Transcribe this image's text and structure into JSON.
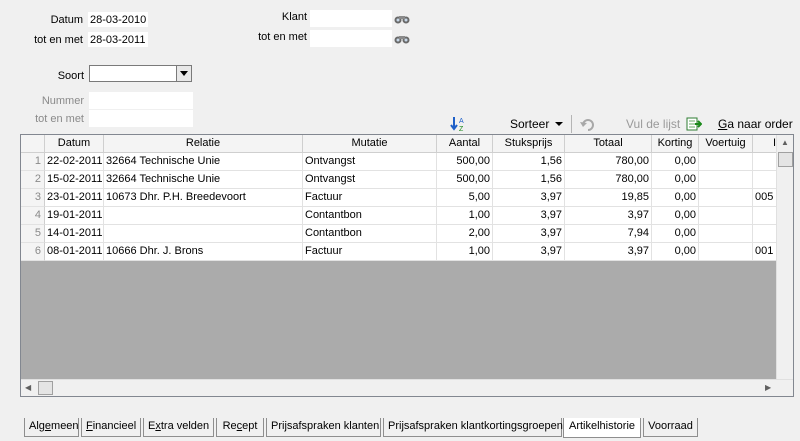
{
  "filters": {
    "datum_label": "Datum",
    "datum_value": "28-03-2010",
    "tot_en_met_label": "tot en met",
    "tot_en_met_value": "28-03-2011",
    "klant_label": "Klant",
    "klant_value": "",
    "klant_tot_label": "tot en met",
    "klant_tot_value": "",
    "soort_label": "Soort",
    "soort_value": "",
    "nummer_label": "Nummer",
    "nummer_value": "",
    "nummer_tot_label": "tot en met",
    "nummer_tot_value": ""
  },
  "toolbar": {
    "sort_icon": "sort-az-icon",
    "sort_label": "Sorteer",
    "fill_icon": "undo-icon",
    "fill_label": "Vul de lijst",
    "goto_icon": "export-green-icon",
    "goto_label": "Ga naar order"
  },
  "grid": {
    "columns": [
      "Datum",
      "Relatie",
      "Mutatie",
      "Aantal",
      "Stuksprijs",
      "Totaal",
      "Korting",
      "Voertuig",
      "I"
    ],
    "rows": [
      {
        "n": "1",
        "datum": "22-02-2011",
        "relatie": "32664 Technische Unie",
        "mutatie": "Ontvangst",
        "aantal": "500,00",
        "stuksprijs": "1,56",
        "totaal": "780,00",
        "korting": "0,00",
        "voertuig": "",
        "extra": ""
      },
      {
        "n": "2",
        "datum": "15-02-2011",
        "relatie": "32664 Technische Unie",
        "mutatie": "Ontvangst",
        "aantal": "500,00",
        "stuksprijs": "1,56",
        "totaal": "780,00",
        "korting": "0,00",
        "voertuig": "",
        "extra": ""
      },
      {
        "n": "3",
        "datum": "23-01-2011",
        "relatie": "10673 Dhr. P.H. Breedevoort",
        "mutatie": "Factuur",
        "aantal": "5,00",
        "stuksprijs": "3,97",
        "totaal": "19,85",
        "korting": "0,00",
        "voertuig": "",
        "extra": "005"
      },
      {
        "n": "4",
        "datum": "19-01-2011",
        "relatie": "",
        "mutatie": "Contantbon",
        "aantal": "1,00",
        "stuksprijs": "3,97",
        "totaal": "3,97",
        "korting": "0,00",
        "voertuig": "",
        "extra": ""
      },
      {
        "n": "5",
        "datum": "14-01-2011",
        "relatie": "",
        "mutatie": "Contantbon",
        "aantal": "2,00",
        "stuksprijs": "3,97",
        "totaal": "7,94",
        "korting": "0,00",
        "voertuig": "",
        "extra": ""
      },
      {
        "n": "6",
        "datum": "08-01-2011",
        "relatie": "10666 Dhr. J. Brons",
        "mutatie": "Factuur",
        "aantal": "1,00",
        "stuksprijs": "3,97",
        "totaal": "3,97",
        "korting": "0,00",
        "voertuig": "",
        "extra": "001"
      }
    ]
  },
  "tabs": [
    {
      "label": "Algemeen"
    },
    {
      "label": "Financieel"
    },
    {
      "label": "Extra velden"
    },
    {
      "label": "Recept"
    },
    {
      "label": "Prijsafspraken klanten"
    },
    {
      "label": "Prijsafspraken klantkortingsgroepen"
    },
    {
      "label": "Artikelhistorie",
      "active": true
    },
    {
      "label": "Voorraad"
    }
  ],
  "colors": {
    "grid_empty": "#ababab",
    "window_bg": "#f0f0f0"
  }
}
